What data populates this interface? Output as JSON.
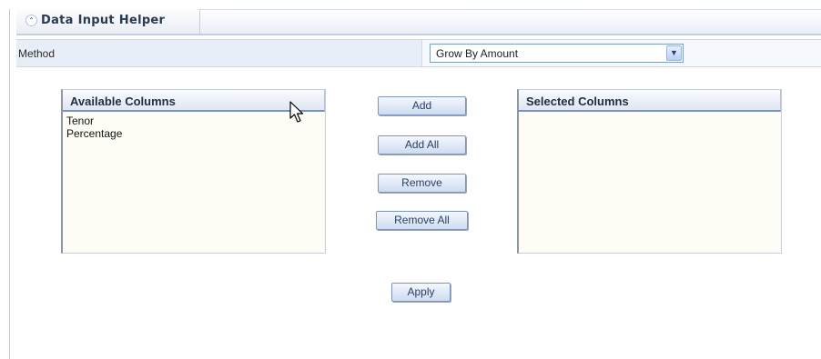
{
  "panel": {
    "title": "Data Input Helper",
    "collapse_icon": "chevron-double-up-icon"
  },
  "method": {
    "label": "Method",
    "selected_value": "Grow By Amount"
  },
  "available_columns": {
    "header": "Available Columns",
    "items": [
      "Tenor",
      "Percentage"
    ]
  },
  "selected_columns": {
    "header": "Selected Columns",
    "items": []
  },
  "buttons": {
    "add": "Add",
    "add_all": "Add All",
    "remove": "Remove",
    "remove_all": "Remove All",
    "apply": "Apply"
  },
  "colors": {
    "header_text": "#2b3a52",
    "method_row_bg": "#e8eef7",
    "list_bg": "#fdfdf6",
    "button_text": "#2a3f62",
    "select_border": "#7f9db9"
  }
}
